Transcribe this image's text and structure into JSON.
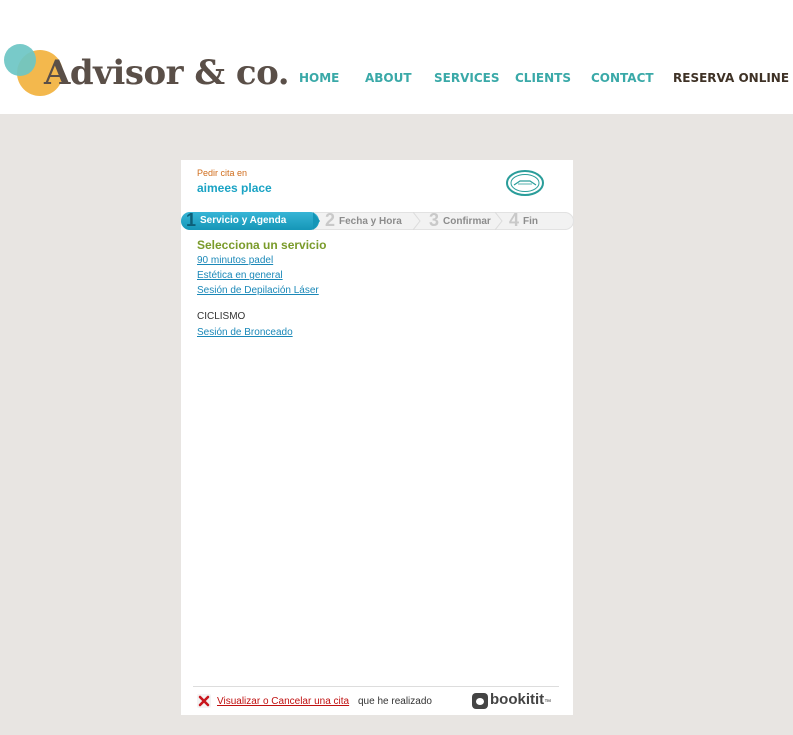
{
  "header": {
    "logo_text": "Advisor & co.",
    "nav": [
      "HOME",
      "ABOUT",
      "SERVICES",
      "CLIENTS",
      "CONTACT",
      "RESERVA ONLINE"
    ]
  },
  "widget": {
    "pedir_label": "Pedir cita en",
    "place_name": "aimees place",
    "steps": [
      {
        "num": "1",
        "label": "Servicio y Agenda"
      },
      {
        "num": "2",
        "label": "Fecha y Hora"
      },
      {
        "num": "3",
        "label": "Confirmar"
      },
      {
        "num": "4",
        "label": "Fin"
      }
    ],
    "select_title": "Selecciona un servicio",
    "services": [
      "90 minutos padel",
      "Estética en general",
      "Sesión de Depilación Láser"
    ],
    "category": "CICLISMO",
    "category_services": [
      "Sesión de Bronceado"
    ],
    "footer": {
      "cancel_link": "Visualizar o Cancelar una cita",
      "cancel_rest": "que he realizado",
      "brand": "bookitit",
      "brand_suffix": "™"
    }
  },
  "colors": {
    "background": "#e8e5e2",
    "nav_teal": "#3aa9a8",
    "nav_dark": "#3f3226",
    "step_active": "#1aa3c4",
    "title_green": "#7a9b2a",
    "link_blue": "#1a88b8",
    "cancel_red": "#c01010"
  }
}
